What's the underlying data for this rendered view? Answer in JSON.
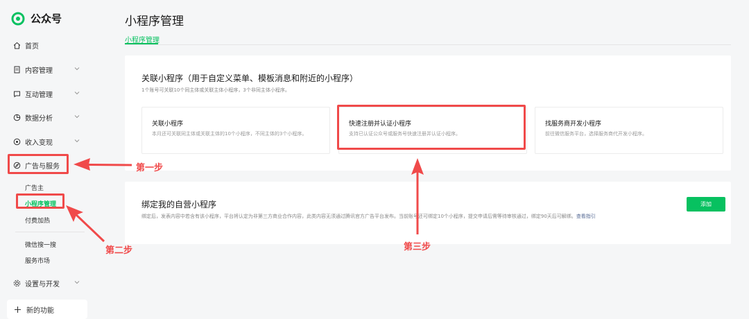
{
  "app": {
    "name": "公众号"
  },
  "sidebar": {
    "items": [
      {
        "label": "首页",
        "icon": "home-icon"
      },
      {
        "label": "内容管理",
        "icon": "document-icon"
      },
      {
        "label": "互动管理",
        "icon": "chat-icon"
      },
      {
        "label": "数据分析",
        "icon": "pie-chart-icon"
      },
      {
        "label": "收入变现",
        "icon": "coin-icon"
      },
      {
        "label": "广告与服务",
        "icon": "compass-icon"
      },
      {
        "label": "设置与开发",
        "icon": "gear-icon"
      }
    ],
    "subitems": [
      "广告主",
      "小程序管理",
      "付费加热",
      "微信搜一搜",
      "服务市场"
    ],
    "new_features": "新的功能"
  },
  "main": {
    "title": "小程序管理",
    "tab": "小程序管理",
    "linked": {
      "title": "关联小程序（用于自定义菜单、模板消息和附近的小程序）",
      "desc": "1个账号可关联10个同主体或关联主体小程序，3个非同主体小程序。",
      "options": [
        {
          "title": "关联小程序",
          "desc": "本月还可关联同主体或关联主体的10个小程序，不同主体的3个小程序。"
        },
        {
          "title": "快速注册并认证小程序",
          "desc": "支持已认证公众号或服务号快速注册并认证小程序。"
        },
        {
          "title": "找服务商开发小程序",
          "desc": "前往微信服务平台，选择服务商代开发小程序。"
        }
      ]
    },
    "own": {
      "title": "绑定我的自营小程序",
      "desc": "绑定后，发表内容中若含有该小程序，平台将认定为非第三方商业合作内容，此类内容无须通过腾讯官方广告平台发布。当前账号还可绑定10个小程序，提交申请后需等待审核通过，绑定90天后可解绑。",
      "link": "查看指引",
      "add_label": "添加"
    }
  },
  "annotations": {
    "step1": "第一步",
    "step2": "第二步",
    "step3": "第三步"
  },
  "colors": {
    "accent": "#07c160",
    "annotation": "#f04a4a",
    "link": "#576b95"
  }
}
